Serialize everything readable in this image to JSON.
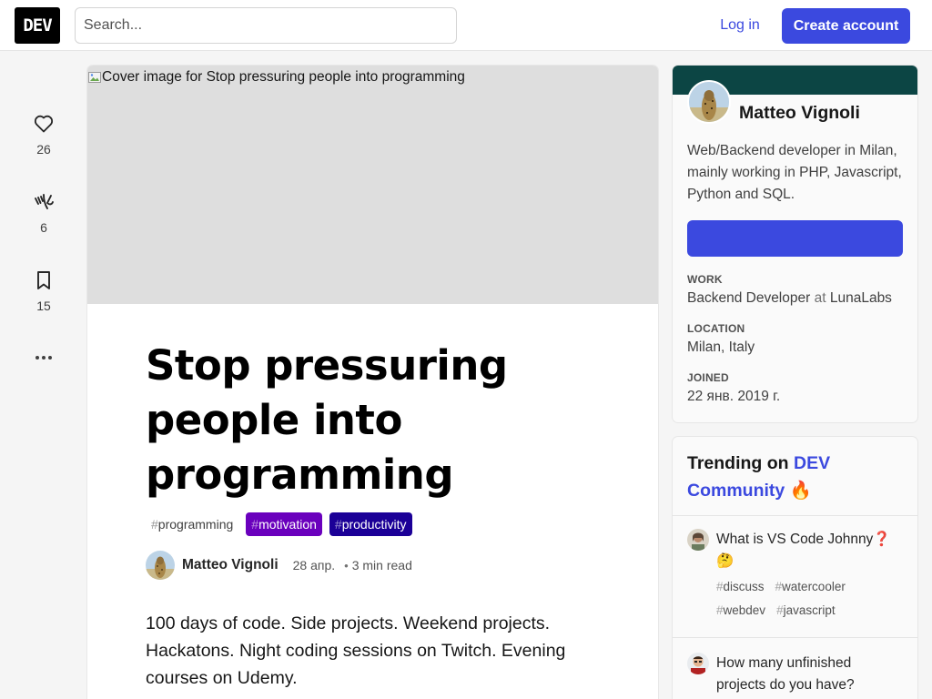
{
  "header": {
    "logo_text": "DEV",
    "search_placeholder": "Search...",
    "login_label": "Log in",
    "create_account_label": "Create account"
  },
  "reactions": {
    "likes": "26",
    "unicorns": "6",
    "bookmarks": "15",
    "icons": [
      "heart-icon",
      "unicorn-icon",
      "bookmark-icon",
      "more-icon"
    ]
  },
  "article": {
    "cover_alt": "Cover image for Stop pressuring people into programming",
    "title": "Stop pressuring people into programming",
    "tags": [
      {
        "hash": "#",
        "name": "programming"
      },
      {
        "hash": "#",
        "name": "motivation"
      },
      {
        "hash": "#",
        "name": "productivity"
      }
    ],
    "author": "Matteo Vignoli",
    "date": "28 апр.",
    "separator": "•",
    "read_time": "3 min read",
    "body": "100 days of code. Side projects. Weekend projects. Hackatons. Night coding sessions on Twitch. Evening courses on Udemy."
  },
  "profile": {
    "name": "Matteo Vignoli",
    "bio": "Web/Backend developer in Milan, mainly working in PHP, Javascript, Python and SQL.",
    "follow_label": "",
    "work_label": "WORK",
    "work_role": "Backend Developer",
    "work_at": "at",
    "work_company": "LunaLabs",
    "location_label": "LOCATION",
    "location": "Milan, Italy",
    "joined_label": "JOINED",
    "joined": "22 янв. 2019 г."
  },
  "trending": {
    "heading_prefix": "Trending on",
    "heading_brand": "DEV Community",
    "heading_emoji": "🔥",
    "items": [
      {
        "title": "What is VS Code Johnny",
        "title_emoji": "❓🤔",
        "tags": [
          "discuss",
          "watercooler",
          "webdev",
          "javascript"
        ]
      },
      {
        "title": "How many unfinished projects do you have?",
        "title_emoji": "",
        "tags": []
      }
    ]
  },
  "colors": {
    "accent": "#3b49df",
    "profile_band": "#0c4544",
    "tag_motivation": "#6a00bd",
    "tag_productivity": "#1b0097"
  }
}
